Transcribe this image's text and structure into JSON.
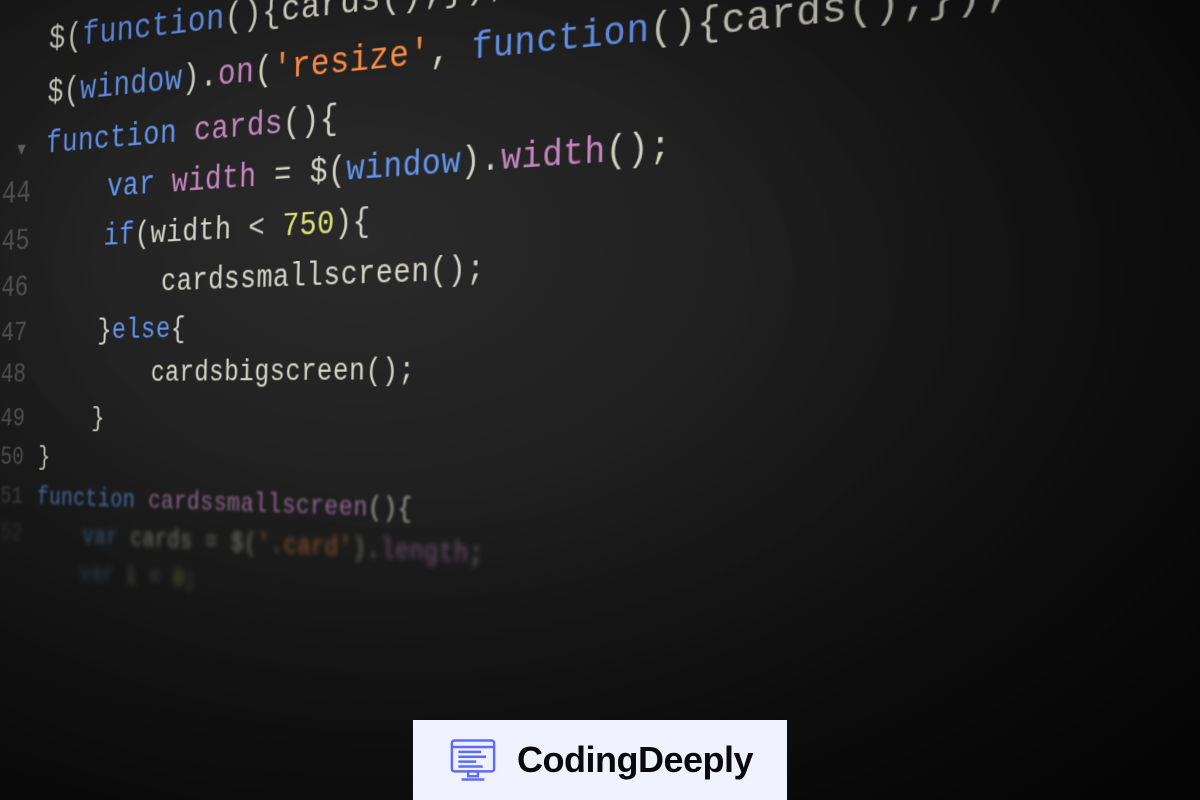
{
  "gutter": {
    "l1": "",
    "l2": "",
    "l3": "",
    "l4": "44",
    "l5": "45",
    "l6": "46",
    "l7": "47",
    "l8": "48",
    "l9": "49",
    "l10": "50",
    "l11": "51",
    "l12": "52",
    "l13": ""
  },
  "code": {
    "l1": {
      "t1": "$(",
      "t2": "function",
      "t3": "(){",
      "t4": "cards",
      "t5": "();});"
    },
    "l2": {
      "t1": "$(",
      "t2": "window",
      "t3": ").",
      "t4": "on",
      "t5": "(",
      "t6": "'resize'",
      "t7": ", ",
      "t8": "function",
      "t9": "(){",
      "t10": "cards",
      "t11": "();});"
    },
    "l3": {
      "t1": "function",
      "t2": " ",
      "t3": "cards",
      "t4": "(){"
    },
    "l4": {
      "t1": "    ",
      "t2": "var",
      "t3": " ",
      "t4": "width",
      "t5": " = $(",
      "t6": "window",
      "t7": ").",
      "t8": "width",
      "t9": "();"
    },
    "l5": {
      "t1": "    ",
      "t2": "if",
      "t3": "(",
      "t4": "width",
      "t5": " < ",
      "t6": "750",
      "t7": "){"
    },
    "l6": {
      "t1": "        ",
      "t2": "cardssmallscreen",
      "t3": "();"
    },
    "l7": {
      "t1": "    }",
      "t2": "else",
      "t3": "{"
    },
    "l8": {
      "t1": "        ",
      "t2": "cardsbigscreen",
      "t3": "();"
    },
    "l9": {
      "t1": "    }"
    },
    "l10": {
      "t1": "}"
    },
    "l11": {
      "t1": "function",
      "t2": " ",
      "t3": "cardssmallscreen",
      "t4": "(){"
    },
    "l12": {
      "t1": "    ",
      "t2": "var",
      "t3": " cards = $(",
      "t4": "'.card'",
      "t5": ").",
      "t6": "length",
      "t7": ";"
    },
    "l13": {
      "t1": "    ",
      "t2": "var",
      "t3": " i = ",
      "t4": "0",
      "t5": ";"
    }
  },
  "watermark": {
    "text": "CodingDeeply"
  }
}
